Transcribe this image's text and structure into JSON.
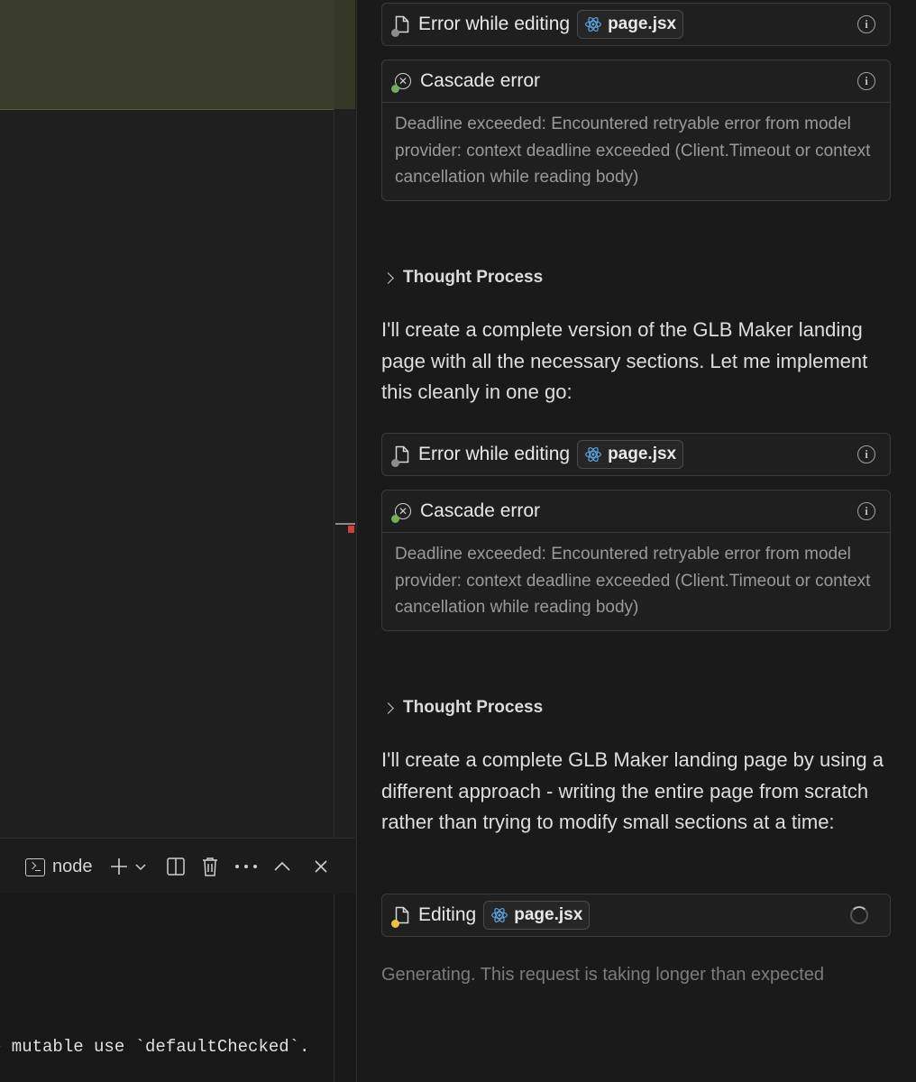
{
  "terminal": {
    "tab_label": "node",
    "output_line": "e mutable use `defaultChecked`."
  },
  "chat": {
    "file_chip": "page.jsx",
    "edit_error_1": {
      "label": "Error while editing"
    },
    "cascade_1": {
      "label": "Cascade error",
      "body": "Deadline exceeded: Encountered retryable error from model provider: context deadline exceeded (Client.Timeout or context cancellation while reading body)"
    },
    "thought_1": "Thought Process",
    "message_1": "I'll create a complete version of the GLB Maker landing page with all the necessary sections. Let me implement this cleanly in one go:",
    "edit_error_2": {
      "label": "Error while editing"
    },
    "cascade_2": {
      "label": "Cascade error",
      "body": "Deadline exceeded: Encountered retryable error from model provider: context deadline exceeded (Client.Timeout or context cancellation while reading body)"
    },
    "thought_2": "Thought Process",
    "message_2": "I'll create a complete GLB Maker landing page by using a different approach - writing the entire page from scratch rather than trying to modify small sections at a time:",
    "editing": {
      "label": "Editing"
    },
    "status": "Generating. This request is taking longer than expected"
  },
  "colors": {
    "dot_grey": "#8d8d8d",
    "dot_green": "#6fae5d",
    "dot_yellow": "#e8c43a",
    "react_blue": "#5aa9e6",
    "error_red": "#d33c3c"
  }
}
